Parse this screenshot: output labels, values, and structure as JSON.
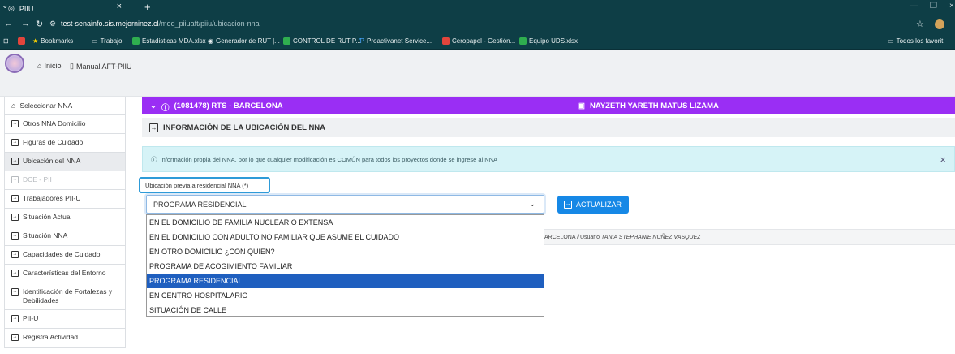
{
  "browser": {
    "tab_title": "PIIU",
    "url_host": "test-senainfo.sis.mejorninez.cl",
    "url_path": "/mod_piiuaft/piiu/ubicacion-nna",
    "bookmarks": [
      {
        "label": "Bookmarks",
        "color": "#ffd400"
      },
      {
        "label": "Trabajo",
        "color": "#0e3e46"
      },
      {
        "label": "Estadisticas MDA.xlsx",
        "color": "#2fae4f"
      },
      {
        "label": "Generador de RUT |...",
        "color": "#ffffff"
      },
      {
        "label": "CONTROL DE RUT P...",
        "color": "#2fae4f"
      },
      {
        "label": "Proactivanet Service...",
        "color": "#4aa8ff"
      },
      {
        "label": "Ceropapel - Gestión...",
        "color": "#e2453c"
      },
      {
        "label": "Equipo UDS.xlsx",
        "color": "#2fae4f"
      }
    ],
    "all_bookmarks": "Todos los favorit"
  },
  "app": {
    "nav": [
      {
        "label": "Inicio"
      },
      {
        "label": "Manual AFT-PIIU"
      }
    ]
  },
  "sidebar": {
    "items": [
      {
        "label": "Seleccionar NNA",
        "state": "normal"
      },
      {
        "label": "Otros NNA Domicilio",
        "state": "normal"
      },
      {
        "label": "Figuras de Cuidado",
        "state": "normal"
      },
      {
        "label": "Ubicación del NNA",
        "state": "active"
      },
      {
        "label": "DCE - PII",
        "state": "disabled"
      },
      {
        "label": "Trabajadores PII-U",
        "state": "normal"
      },
      {
        "label": "Situación Actual",
        "state": "normal"
      },
      {
        "label": "Situación NNA",
        "state": "normal"
      },
      {
        "label": "Capacidades de Cuidado",
        "state": "normal"
      },
      {
        "label": "Características del Entorno",
        "state": "normal"
      },
      {
        "label": "Identificación de Fortalezas y Debilidades",
        "state": "normal"
      },
      {
        "label": "PII-U",
        "state": "normal"
      },
      {
        "label": "Registra Actividad",
        "state": "normal"
      }
    ]
  },
  "header": {
    "project": "(1081478) RTS - BARCELONA",
    "person": "NAYZETH YARETH MATUS LIZAMA",
    "section_title": "INFORMACIÓN DE LA UBICACIÓN DEL NNA"
  },
  "alert": {
    "text": "Información propia del NNA, por lo que cualquier modificación es COMÚN para todos los proyectos donde se ingrese al NNA"
  },
  "form": {
    "label": "Ubicación previa a residencial NNA (*)",
    "selected": "PROGRAMA RESIDENCIAL",
    "button": "ACTUALIZAR",
    "options": [
      "EN EL DOMICILIO DE FAMILIA NUCLEAR O EXTENSA",
      "EN EL DOMICILIO CON ADULTO NO FAMILIAR QUE ASUME EL CUIDADO",
      "EN OTRO DOMICILIO ¿CON QUIÉN?",
      "PROGRAMA DE ACOGIMIENTO FAMILIAR",
      "PROGRAMA RESIDENCIAL",
      "EN CENTRO HOSPITALARIO",
      "SITUACIÓN DE CALLE"
    ],
    "selected_index": 4
  },
  "footer_info": {
    "prefix": "ARCELONA / Usuario ",
    "user": "TANIA STEPHANIE NUÑEZ VASQUEZ"
  },
  "colors": {
    "browser_chrome": "#0e3e46",
    "header_purple": "#9a2ef4",
    "button_blue": "#1688e6",
    "option_selected": "#1f5fbf",
    "alert_bg": "#d6f3f7",
    "label_highlight": "#2e9bd8"
  }
}
